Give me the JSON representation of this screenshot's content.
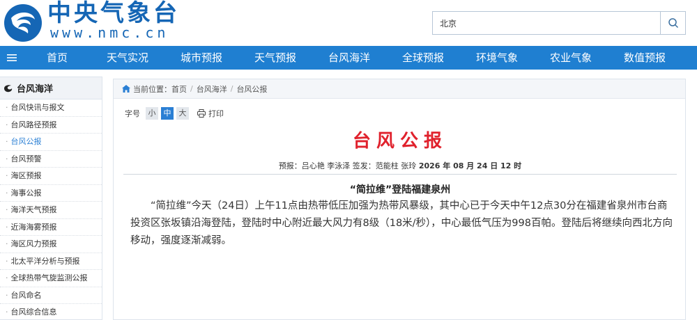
{
  "header": {
    "brand_cn": "中央气象台",
    "brand_url": "www.nmc.cn",
    "search": {
      "value": "北京"
    }
  },
  "nav": {
    "items": [
      "首页",
      "天气实况",
      "城市预报",
      "天气预报",
      "台风海洋",
      "全球预报",
      "环境气象",
      "农业气象",
      "数值预报"
    ]
  },
  "sidebar": {
    "title": "台风海洋",
    "items": [
      {
        "label": "台风快讯与报文"
      },
      {
        "label": "台风路径预报"
      },
      {
        "label": "台风公报",
        "active": true
      },
      {
        "label": "台风预警"
      },
      {
        "label": "海区预报"
      },
      {
        "label": "海事公报"
      },
      {
        "label": "海洋天气预报"
      },
      {
        "label": "近海海雾预报"
      },
      {
        "label": "海区风力预报"
      },
      {
        "label": "北太平洋分析与预报"
      },
      {
        "label": "全球热带气旋监测公报"
      },
      {
        "label": "台风命名"
      },
      {
        "label": "台风综合信息"
      }
    ]
  },
  "breadcrumb": {
    "prefix": "当前位置：",
    "items": [
      "首页",
      "台风海洋",
      "台风公报"
    ]
  },
  "font_tools": {
    "label": "字号",
    "small": "小",
    "medium": "中",
    "large": "大",
    "print": "打印"
  },
  "document": {
    "title": "台风公报",
    "meta_people": "预报：吕心艳 李泳泽  签发：范能柱 张玲",
    "meta_time": "2026 年 08 月 24 日 12 时",
    "headline": "“简拉维”登陆福建泉州",
    "body": "“简拉维”今天（24日）上午11点由热带低压加强为热带风暴级，其中心已于今天中午12点30分在福建省泉州市台商投资区张坂镇沿海登陆，登陆时中心附近最大风力有8级（18米/秒），中心最低气压为998百帕。登陆后将继续向西北方向移动，强度逐渐减弱。"
  },
  "colors": {
    "brand_blue": "#1566b5",
    "nav_blue": "#1f7fd1",
    "title_red": "#e0212c",
    "active_link": "#2a7fd4"
  }
}
